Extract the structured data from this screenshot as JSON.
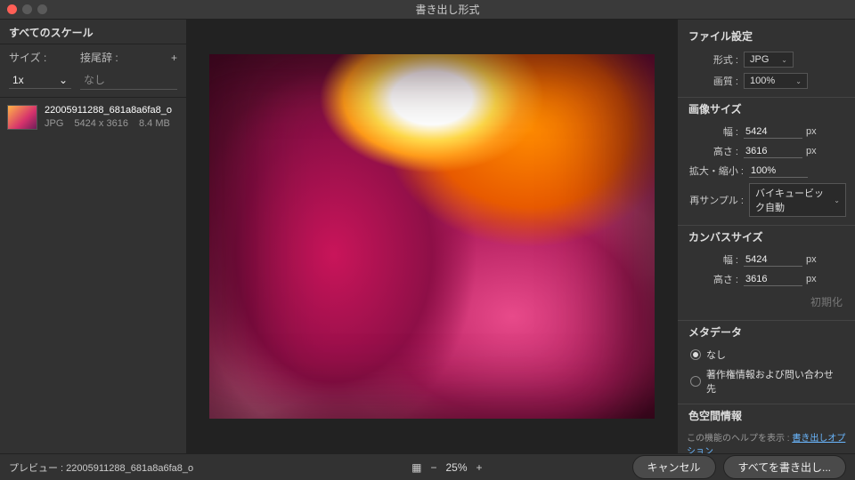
{
  "window": {
    "title": "書き出し形式"
  },
  "left": {
    "header": "すべてのスケール",
    "size_label": "サイズ :",
    "suffix_label": "接尾辞 :",
    "size_value": "1x",
    "suffix_value": "なし",
    "asset": {
      "name": "22005911288_681a8a6fa8_o",
      "format": "JPG",
      "dimensions": "5424 x 3616",
      "filesize": "8.4 MB"
    }
  },
  "right": {
    "file_settings": "ファイル設定",
    "format_label": "形式 :",
    "format_value": "JPG",
    "quality_label": "画質 :",
    "quality_value": "100%",
    "image_size": "画像サイズ",
    "width_label": "幅 :",
    "width_value": "5424",
    "height_label": "高さ :",
    "height_value": "3616",
    "scale_label": "拡大・縮小 :",
    "scale_value": "100%",
    "resample_label": "再サンプル :",
    "resample_value": "バイキュービック自動",
    "canvas_size": "カンバスサイズ",
    "canvas_w": "5424",
    "canvas_h": "3616",
    "reset": "初期化",
    "metadata": "メタデータ",
    "meta_none": "なし",
    "meta_copyright": "著作権情報および問い合わせ先",
    "colorspace": "色空間情報",
    "help_prefix": "この機能のヘルプを表示 : ",
    "help_link": "書き出しオプション",
    "px": "px"
  },
  "footer": {
    "preview_prefix": "プレビュー : ",
    "preview_name": "22005911288_681a8a6fa8_o",
    "zoom": "25%",
    "cancel": "キャンセル",
    "export_all": "すべてを書き出し..."
  }
}
